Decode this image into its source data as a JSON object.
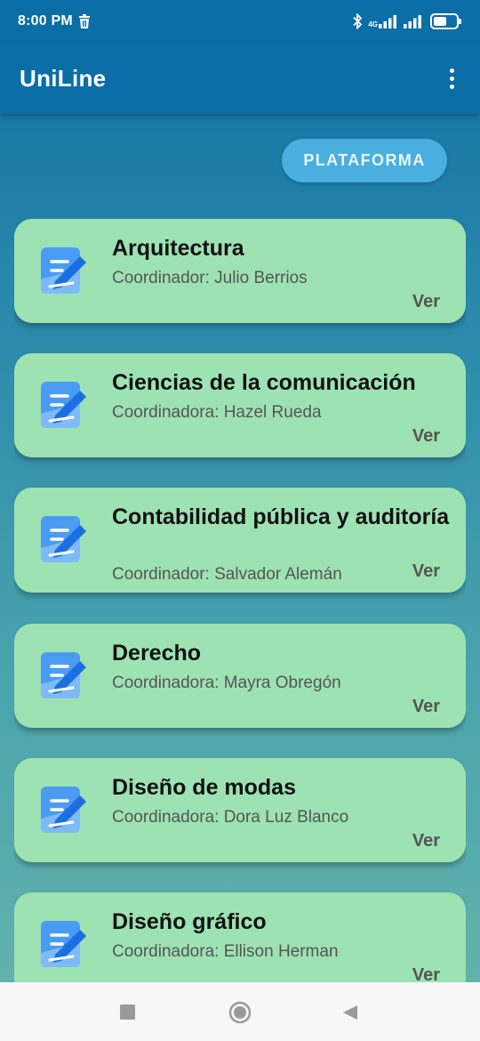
{
  "status_bar": {
    "time": "8:00 PM",
    "network_label": "4G"
  },
  "app_bar": {
    "title": "UniLine"
  },
  "platform_button": {
    "label": "PLATAFORMA"
  },
  "careers": [
    {
      "title": "Arquitectura",
      "coordinator": "Coordinador: Julio Berrios",
      "action": "Ver"
    },
    {
      "title": "Ciencias de la comunicación",
      "coordinator": "Coordinadora: Hazel Rueda",
      "action": "Ver"
    },
    {
      "title": "Contabilidad pública y auditoría",
      "coordinator": "Coordinador: Salvador Alemán",
      "action": "Ver"
    },
    {
      "title": "Derecho",
      "coordinator": "Coordinadora: Mayra Obregón",
      "action": "Ver"
    },
    {
      "title": "Diseño de modas",
      "coordinator": "Coordinadora: Dora Luz Blanco",
      "action": "Ver"
    },
    {
      "title": "Diseño gráfico",
      "coordinator": "Coordinadora: Ellison Herman",
      "action": "Ver"
    }
  ],
  "colors": {
    "app_bar": "#0b6ea6",
    "card": "#9de2b3",
    "platform_button": "#4aaede",
    "icon": "#2f8ff0"
  },
  "icons": {
    "card": "edit-note-icon",
    "menu": "more-vert-icon",
    "nav": [
      "stop-square-icon",
      "home-circle-icon",
      "back-triangle-icon"
    ]
  }
}
